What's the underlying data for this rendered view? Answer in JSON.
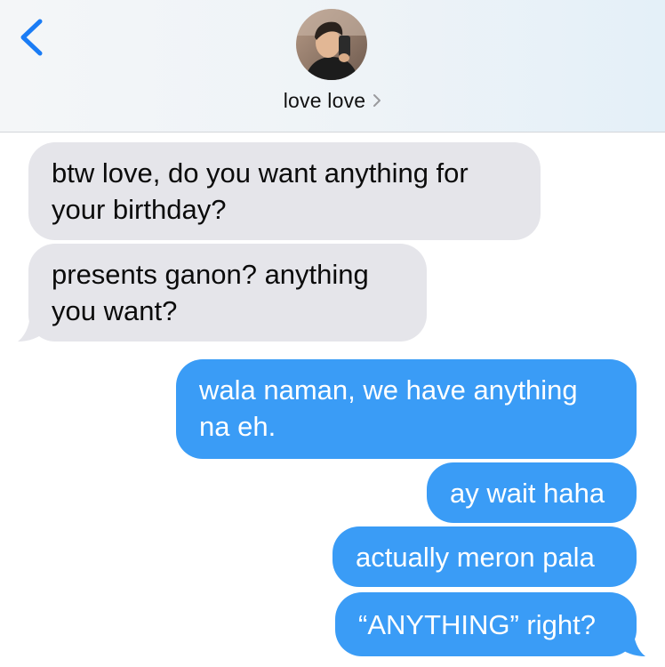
{
  "header": {
    "back_icon": "chevron-left-icon",
    "avatar_icon": "contact-avatar",
    "contact_name": "love love",
    "contact_chevron_icon": "chevron-right-icon",
    "accent_color": "#1a7cf5"
  },
  "messages": [
    {
      "sender": "them",
      "lines": [
        "btw love, do you want anything for",
        "your birthday?"
      ]
    },
    {
      "sender": "them",
      "lines": [
        "presents ganon? anything",
        "you want?"
      ]
    },
    {
      "sender": "me",
      "lines": [
        "wala naman, we have anything",
        "na eh."
      ]
    },
    {
      "sender": "me",
      "lines": [
        "ay wait haha"
      ]
    },
    {
      "sender": "me",
      "lines": [
        "actually meron pala"
      ]
    },
    {
      "sender": "me",
      "lines": [
        "“ANYTHING” right?"
      ]
    }
  ],
  "colors": {
    "incoming_bubble": "#e5e5ea",
    "outgoing_bubble": "#3a9cf6"
  }
}
